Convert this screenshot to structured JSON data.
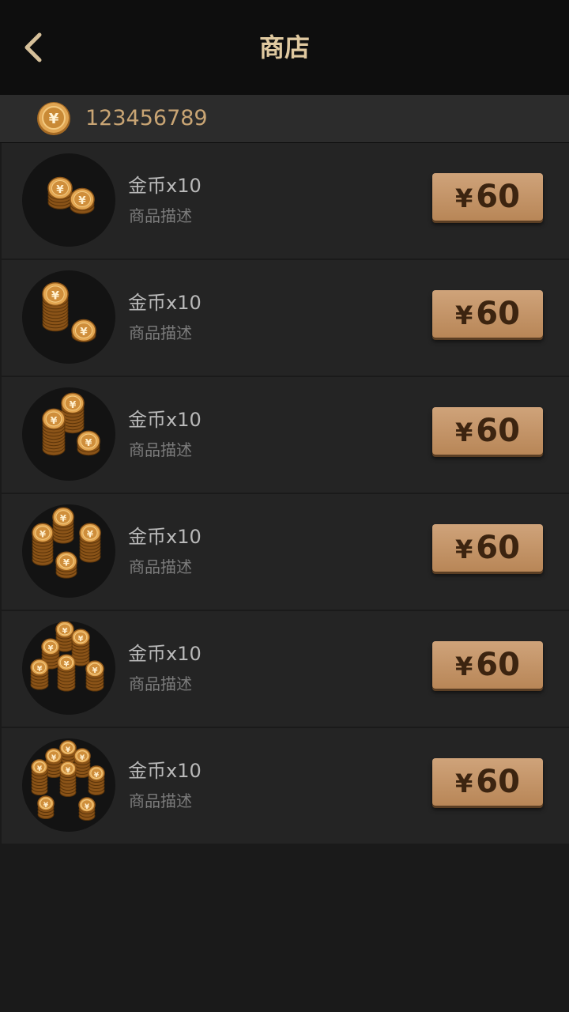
{
  "header": {
    "title": "商店",
    "back_icon": "chevron-left-icon"
  },
  "balance": {
    "icon": "coin-icon",
    "value": "123456789"
  },
  "items": [
    {
      "name": "金币x10",
      "desc": "商品描述",
      "currency": "¥",
      "price": "60",
      "icon": "coin-pile-icon"
    },
    {
      "name": "金币x10",
      "desc": "商品描述",
      "currency": "¥",
      "price": "60",
      "icon": "coin-stack-icon"
    },
    {
      "name": "金币x10",
      "desc": "商品描述",
      "currency": "¥",
      "price": "60",
      "icon": "coin-stacks-icon"
    },
    {
      "name": "金币x10",
      "desc": "商品描述",
      "currency": "¥",
      "price": "60",
      "icon": "coin-stacks-icon"
    },
    {
      "name": "金币x10",
      "desc": "商品描述",
      "currency": "¥",
      "price": "60",
      "icon": "coin-towers-icon"
    },
    {
      "name": "金币x10",
      "desc": "商品描述",
      "currency": "¥",
      "price": "60",
      "icon": "coin-hoard-icon"
    }
  ],
  "colors": {
    "accent": "#e0c9a0",
    "button": "#c49668",
    "background": "#1a1a1a"
  }
}
